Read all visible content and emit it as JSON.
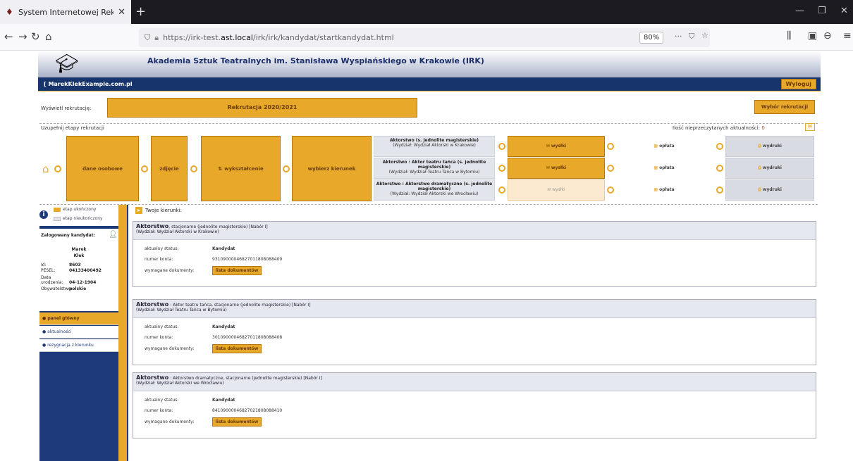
{
  "browser": {
    "tab_title": "System Internetowej Rekrutacji",
    "url_prefix": "https://irk-test.",
    "url_domain": "ast.local",
    "url_path": "/irk/irk/kandydat/startkandydat.html",
    "zoom": "80%"
  },
  "header": {
    "title": "Akademia Sztuk Teatralnych im. Stanisława Wyspiańskiego w Krakowie (IRK)",
    "user_email": "[ MarekKlekExample.com.pl",
    "logout": "Wyloguj"
  },
  "recruitment": {
    "label": "Wyświetl rekrutację:",
    "value": "Rekrutacja 2020/2021",
    "choose_btn": "Wybór rekrutacji"
  },
  "steps": {
    "label": "Uzupełnij etapy rekrutacji",
    "unread_label": "Ilość nieprzeczytanych aktualności:",
    "unread_count": "0",
    "items": [
      "dane osobowe",
      "zdjęcie",
      "wykształcenie",
      "wybierz kierunek"
    ],
    "programs": [
      {
        "name": "Aktorstwo (s. jednolite magisterskie)",
        "faculty": "(Wydział: Wydział Aktorski w Krakowie)",
        "status": "wysłki",
        "payment": "opłata",
        "print": "wydruki",
        "pale": false
      },
      {
        "name": "Aktorstwo : Aktor teatru tańca (s. jednolite magisterskie)",
        "faculty": "(Wydział: Wydział Teatru Tańca w Bytomiu)",
        "status": "wysłki",
        "payment": "opłata",
        "print": "wydruki",
        "pale": false
      },
      {
        "name": "Aktorstwo : Aktorstwo dramatyczne (s. jednolite magisterskie)",
        "faculty": "(Wydział: Wydział Aktorski we Wrocławiu)",
        "status": "wysłki",
        "payment": "opłata",
        "print": "wydruki",
        "pale": true
      }
    ]
  },
  "legend": {
    "done": "etap ukończony",
    "undone": "etap nieukończony"
  },
  "candidate": {
    "title": "Zalogowany kandydat:",
    "first": "Marek",
    "last": "Klek",
    "id_label": "Id:",
    "id": "8603",
    "pesel_label": "PESEL:",
    "pesel": "04133400492",
    "dob_label": "Data urodzenia:",
    "dob": "04-12-1904",
    "cit_label": "Obywatelstwo:",
    "cit": "polskie"
  },
  "menu": [
    "panel główny",
    "aktualności",
    "rezygnacja z kierunku"
  ],
  "main": {
    "title": "Twoje kierunki:",
    "status_label": "aktualny status:",
    "account_label": "numer konta:",
    "docs_label": "wymagane dokumenty:",
    "docs_btn": "lista dokumentów",
    "cards": [
      {
        "name": "Aktorstwo",
        "mode": ", stacjonarne (jednolite magisterskie) [Nabór I]",
        "faculty": "(Wydział: Wydział Aktorski w Krakowie)",
        "status": "Kandydat",
        "account": "93109000046827011808088409"
      },
      {
        "name": "Aktorstwo",
        "mode": " : Aktor teatru tańca, stacjonarne (jednolite magisterskie) [Nabór I]",
        "faculty": "(Wydział: Wydział Teatru Tańca w Bytomiu)",
        "status": "Kandydat",
        "account": "30109000046827011808088408"
      },
      {
        "name": "Aktorstwo",
        "mode": " : Aktorstwo dramatyczne, stacjonarne (jednolite magisterskie) [Nabór I]",
        "faculty": "(Wydział: Wydział Aktorski we Wrocławiu)",
        "status": "Kandydat",
        "account": "84109000046827021808088410"
      }
    ]
  },
  "colors": {
    "accent": "#e8a82a",
    "navy": "#1e3a7b"
  }
}
